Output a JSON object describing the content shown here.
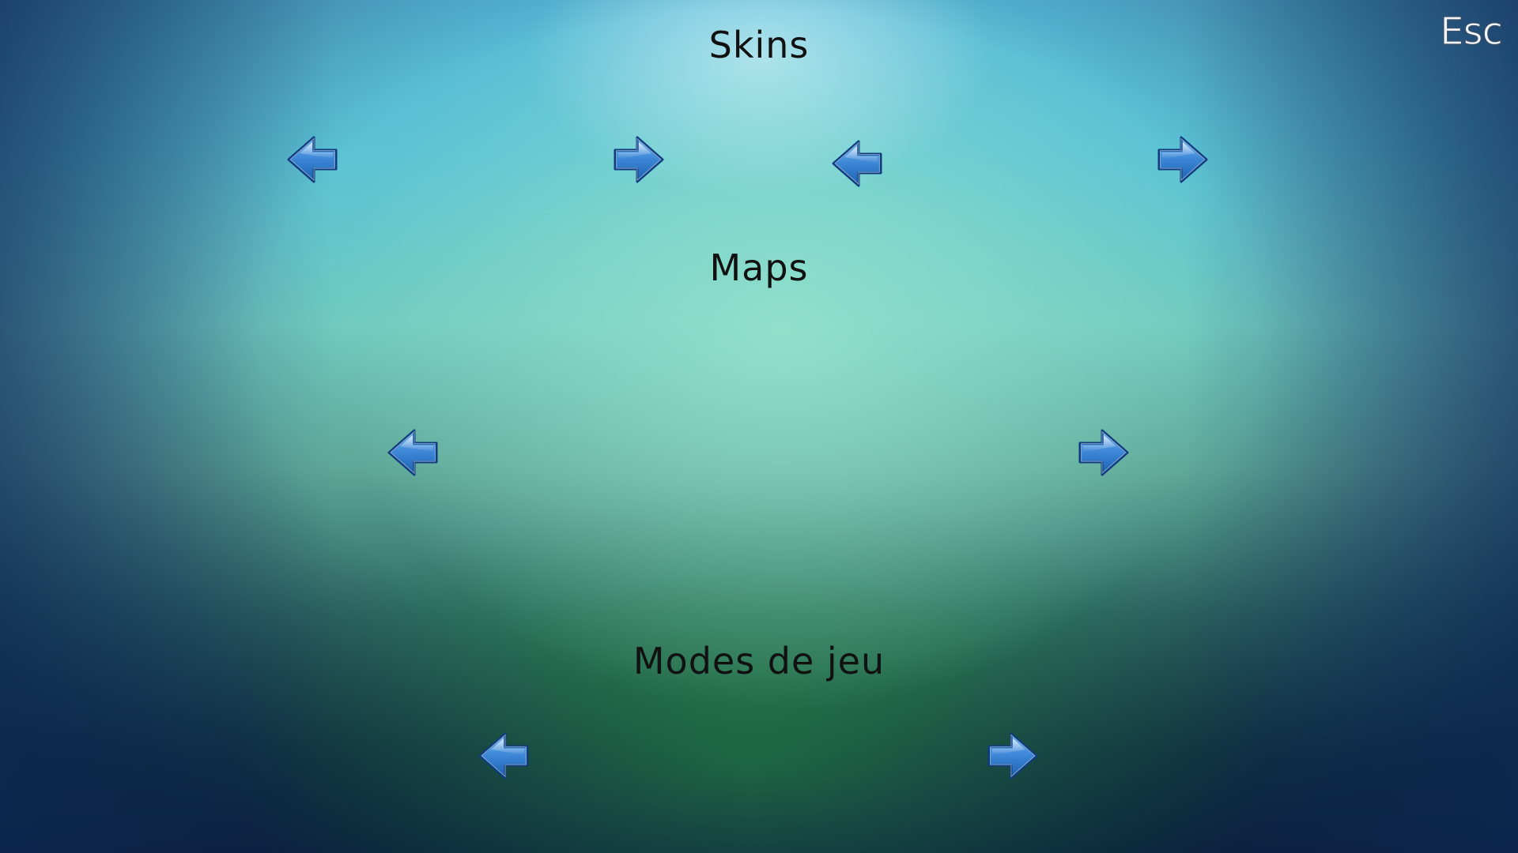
{
  "screen": {
    "esc_label": "Esc"
  },
  "sections": {
    "skins": {
      "title": "Skins"
    },
    "maps": {
      "title": "Maps"
    },
    "modes": {
      "title": "Modes de jeu"
    }
  },
  "icons": {
    "left": "arrow-left-icon",
    "right": "arrow-right-icon"
  },
  "colors": {
    "arrow_fill_light": "#6fb4ee",
    "arrow_fill_dark": "#1a5fae",
    "arrow_outline": "#0d3d80",
    "title_text": "#111111"
  }
}
